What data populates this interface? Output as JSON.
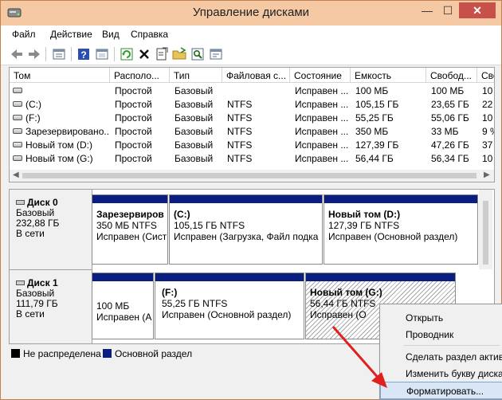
{
  "window": {
    "title": "Управление дисками",
    "close_glyph": "✕",
    "min_glyph": "—",
    "max_glyph": "☐"
  },
  "menu": [
    "Файл",
    "Действие",
    "Вид",
    "Справка"
  ],
  "toolbar_icons": [
    "back-arrow-icon",
    "forward-arrow-icon",
    "properties-icon",
    "help-icon",
    "console-icon",
    "refresh-icon",
    "delete-icon",
    "open-icon",
    "folder-icon",
    "search-icon",
    "rescan-icon"
  ],
  "volume_table": {
    "columns": [
      "Том",
      "Располо...",
      "Тип",
      "Файловая с...",
      "Состояние",
      "Емкость",
      "Свобод...",
      "Сво"
    ],
    "rows": [
      [
        "",
        "Простой",
        "Базовый",
        "",
        "Исправен ...",
        "100 МБ",
        "100 МБ",
        "10"
      ],
      [
        "(C:)",
        "Простой",
        "Базовый",
        "NTFS",
        "Исправен ...",
        "105,15 ГБ",
        "23,65 ГБ",
        "22"
      ],
      [
        "(F:)",
        "Простой",
        "Базовый",
        "NTFS",
        "Исправен ...",
        "55,25 ГБ",
        "55,06 ГБ",
        "10"
      ],
      [
        "Зарезервировано...",
        "Простой",
        "Базовый",
        "NTFS",
        "Исправен ...",
        "350 МБ",
        "33 МБ",
        "9 %"
      ],
      [
        "Новый том (D:)",
        "Простой",
        "Базовый",
        "NTFS",
        "Исправен ...",
        "127,39 ГБ",
        "47,26 ГБ",
        "37"
      ],
      [
        "Новый том (G:)",
        "Простой",
        "Базовый",
        "NTFS",
        "Исправен ...",
        "56,44 ГБ",
        "56,34 ГБ",
        "10"
      ]
    ]
  },
  "disks": [
    {
      "name": "Диск 0",
      "type": "Базовый",
      "size": "232,88 ГБ",
      "status": "В сети",
      "partitions": [
        {
          "title": "Зарезервиров",
          "line1": "350 МБ NTFS",
          "line2": "Исправен (Сист"
        },
        {
          "title": "(C:)",
          "line1": "105,15 ГБ NTFS",
          "line2": "Исправен (Загрузка, Файл подка"
        },
        {
          "title": "Новый том  (D:)",
          "line1": "127,39 ГБ NTFS",
          "line2": "Исправен (Основной раздел)"
        }
      ]
    },
    {
      "name": "Диск 1",
      "type": "Базовый",
      "size": "111,79 ГБ",
      "status": "В сети",
      "partitions": [
        {
          "title": "",
          "line1": "100 МБ",
          "line2": "Исправен (А"
        },
        {
          "title": "(F:)",
          "line1": "55,25 ГБ NTFS",
          "line2": "Исправен (Основной раздел)"
        },
        {
          "title": "Новый том  (G:)",
          "line1": "56,44 ГБ NTFS",
          "line2": "Исправен (О"
        }
      ]
    }
  ],
  "legend": [
    {
      "label": "Не распределена",
      "color": "#000000"
    },
    {
      "label": "Основной раздел",
      "color": "#0a1e82"
    }
  ],
  "context_menu": [
    "Открыть",
    "Проводник",
    "Сделать раздел активн",
    "Изменить букву диска",
    "Форматировать..."
  ],
  "colors": {
    "partition_bar": "#0a1e82",
    "annotation_arrow": "#e02020",
    "titlebar": "#f6c9a5"
  }
}
